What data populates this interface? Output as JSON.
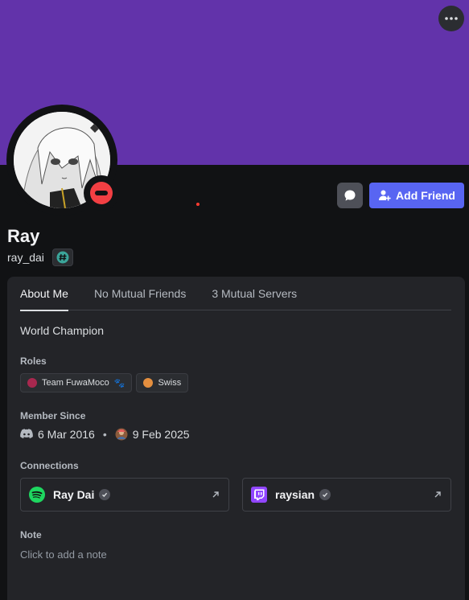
{
  "colors": {
    "banner": "#6233aa",
    "background": "#111214",
    "card": "#232428",
    "accent": "#5865f2",
    "status_dnd": "#f23f43"
  },
  "header": {
    "more_icon": "ellipsis-icon"
  },
  "profile": {
    "display_name": "Ray",
    "username": "ray_dai",
    "badge_icon": "hash-badge-icon",
    "status": "do-not-disturb"
  },
  "actions": {
    "message_icon": "chat-bubble-icon",
    "add_friend_label": "Add Friend"
  },
  "tabs": [
    {
      "label": "About Me",
      "active": true
    },
    {
      "label": "No Mutual Friends",
      "active": false
    },
    {
      "label": "3 Mutual Servers",
      "active": false
    }
  ],
  "about": {
    "bio": "World Champion",
    "roles_title": "Roles",
    "roles": [
      {
        "name": "Team FuwaMoco",
        "color": "#a8284f",
        "emoji": "🐾"
      },
      {
        "name": "Swiss",
        "color": "#e58f3f"
      }
    ],
    "member_since_title": "Member Since",
    "discord_since": "6 Mar 2016",
    "server_since": "9 Feb 2025",
    "connections_title": "Connections",
    "connections": [
      {
        "service": "spotify",
        "name": "Ray Dai",
        "color": "#1ed760"
      },
      {
        "service": "twitch",
        "name": "raysian",
        "color": "#9146ff"
      }
    ],
    "note_title": "Note",
    "note_placeholder": "Click to add a note"
  }
}
